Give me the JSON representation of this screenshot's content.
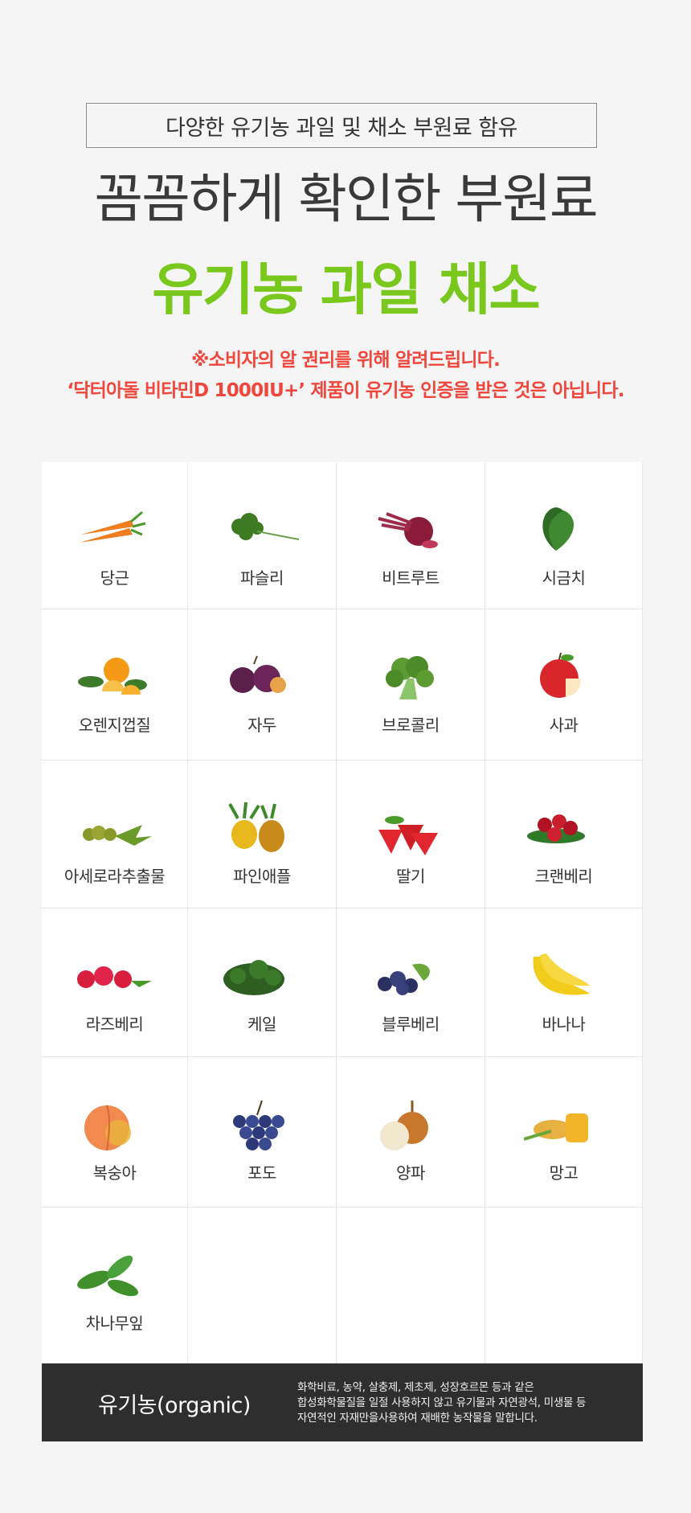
{
  "header": {
    "tag": "다양한 유기농 과일 및 채소 부원료 함유",
    "title": "꼼꼼하게 확인한 부원료",
    "highlight": "유기농 과일 채소",
    "notice_line1": "※소비자의 알 권리를 위해 알려드립니다.",
    "notice_line2": "‘닥터아돌 비타민D 1000IU+’ 제품이 유기농 인증을 받은 것은 아닙니다."
  },
  "ingredients": [
    {
      "label": "당근",
      "icon": "carrot-icon",
      "color": "#f07d1e"
    },
    {
      "label": "파슬리",
      "icon": "parsley-icon",
      "color": "#3e7a22"
    },
    {
      "label": "비트루트",
      "icon": "beetroot-icon",
      "color": "#8a1c3a"
    },
    {
      "label": "시금치",
      "icon": "spinach-icon",
      "color": "#2f6b25"
    },
    {
      "label": "오렌지껍질",
      "icon": "orange-peel-icon",
      "color": "#f59a14"
    },
    {
      "label": "자두",
      "icon": "plum-icon",
      "color": "#5a1f4a"
    },
    {
      "label": "브로콜리",
      "icon": "broccoli-icon",
      "color": "#5c9a32"
    },
    {
      "label": "사과",
      "icon": "apple-icon",
      "color": "#d8262c"
    },
    {
      "label": "아세로라추출물",
      "icon": "acerola-icon",
      "color": "#8a9a2a"
    },
    {
      "label": "파인애플",
      "icon": "pineapple-icon",
      "color": "#e6b81c"
    },
    {
      "label": "딸기",
      "icon": "strawberry-icon",
      "color": "#e0262e"
    },
    {
      "label": "크랜베리",
      "icon": "cranberry-icon",
      "color": "#b01424"
    },
    {
      "label": "라즈베리",
      "icon": "raspberry-icon",
      "color": "#d81e3c"
    },
    {
      "label": "케일",
      "icon": "kale-icon",
      "color": "#2e5e22"
    },
    {
      "label": "블루베리",
      "icon": "blueberry-icon",
      "color": "#2a3060"
    },
    {
      "label": "바나나",
      "icon": "banana-icon",
      "color": "#f2cc1a"
    },
    {
      "label": "복숭아",
      "icon": "peach-icon",
      "color": "#f28a50"
    },
    {
      "label": "포도",
      "icon": "grape-icon",
      "color": "#2c3a7a"
    },
    {
      "label": "양파",
      "icon": "onion-icon",
      "color": "#c8782c"
    },
    {
      "label": "망고",
      "icon": "mango-icon",
      "color": "#f2b428"
    },
    {
      "label": "차나무잎",
      "icon": "tea-leaf-icon",
      "color": "#3f8f2a"
    }
  ],
  "footer": {
    "title": "유기농(organic)",
    "desc_line1": "화학비료, 농약, 살충제, 제초제, 성장호르몬 등과 같은",
    "desc_line2": "합성화학물질을 일절 사용하지 않고 유기물과 자연광석, 미생물 등",
    "desc_line3": "자연적인 자재만을사용하여 재배한 농작물을 말합니다."
  }
}
